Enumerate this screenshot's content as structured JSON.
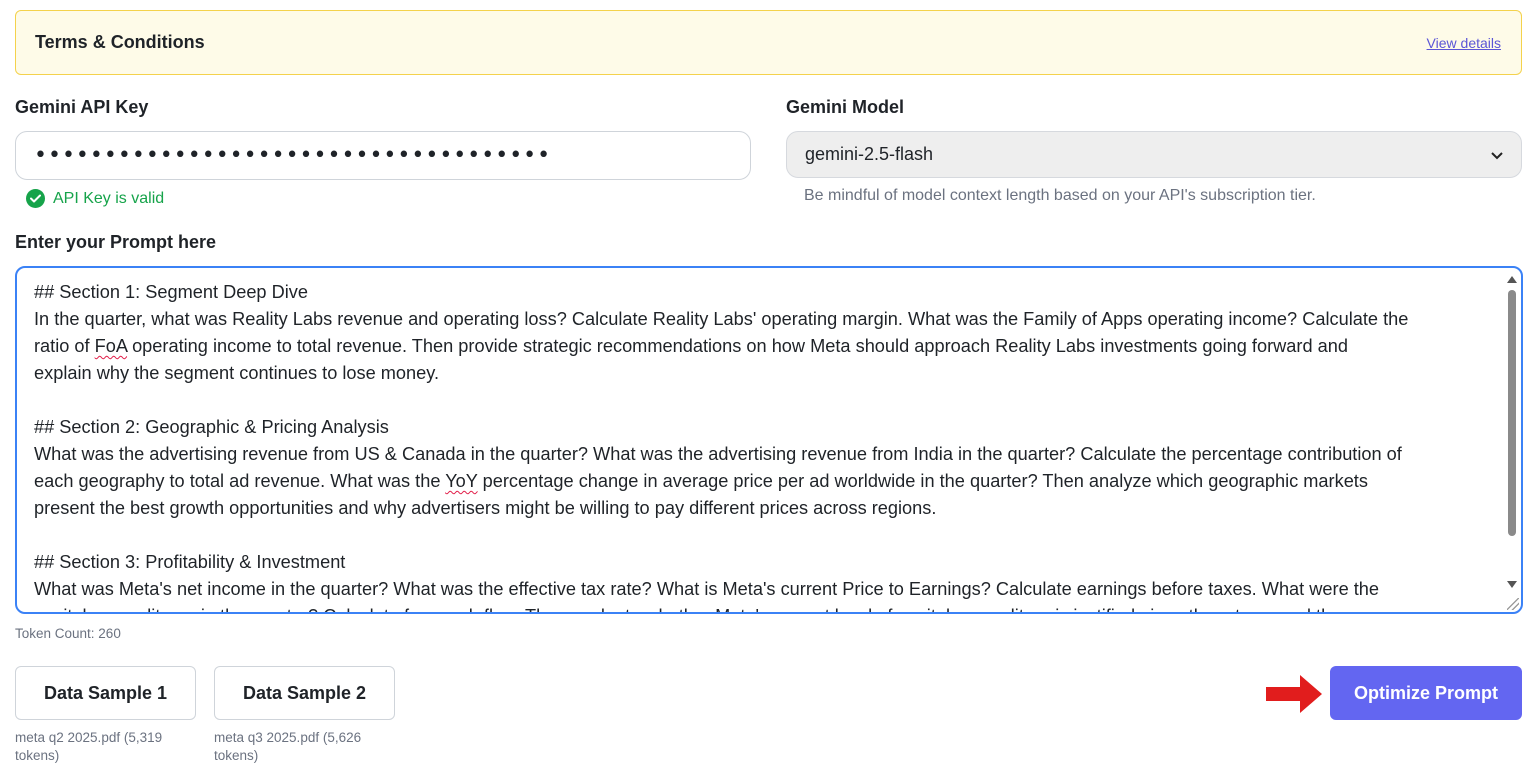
{
  "terms": {
    "title": "Terms & Conditions",
    "link": "View details"
  },
  "api_key": {
    "label": "Gemini API Key",
    "masked_value": "•••••••••••••••••••••••••••••••••••••",
    "status": "API Key is valid",
    "status_color": "#16a34a"
  },
  "model": {
    "label": "Gemini Model",
    "selected": "gemini-2.5-flash",
    "hint": "Be mindful of model context length based on your API's subscription tier."
  },
  "prompt": {
    "label": "Enter your Prompt here",
    "lines": [
      "## Section 1: Segment Deep Dive",
      "In the quarter, what was Reality Labs revenue and operating loss? Calculate Reality Labs' operating margin. What was the Family of Apps operating income? Calculate the",
      "ratio of FoA operating income to total revenue. Then provide strategic recommendations on how Meta should approach Reality Labs investments going forward and",
      "explain why the segment continues to lose money.",
      "",
      "## Section 2: Geographic & Pricing Analysis",
      "What was the advertising revenue from US & Canada in the quarter? What was the advertising revenue from India in the quarter?  Calculate the percentage contribution of",
      "each geography to total ad revenue. What was the YoY percentage change in average price per ad worldwide in the quarter? Then analyze which geographic markets",
      "present the best growth opportunities and why advertisers might be willing to pay different prices across regions.",
      "",
      "## Section 3: Profitability & Investment",
      "What was Meta's net income in the quarter? What was the effective tax rate? What is Meta's current Price to Earnings? Calculate earnings before taxes. What were the",
      "capital expenditures in the quarter? Calculate free cash flow. Then evaluate whether Meta's current level of capital expenditure is justified given the returns and the"
    ],
    "token_count": "Token Count: 260",
    "focus_color": "#3b82f6"
  },
  "samples": [
    {
      "label": "Data Sample 1",
      "caption": "meta q2 2025.pdf (5,319 tokens)"
    },
    {
      "label": "Data Sample 2",
      "caption": "meta q3 2025.pdf (5,626 tokens)"
    }
  ],
  "actions": {
    "optimize_label": "Optimize Prompt",
    "optimize_color": "#6366f1",
    "arrow_color": "#e11d1d",
    "arrow_icon": "right-arrow-icon"
  }
}
